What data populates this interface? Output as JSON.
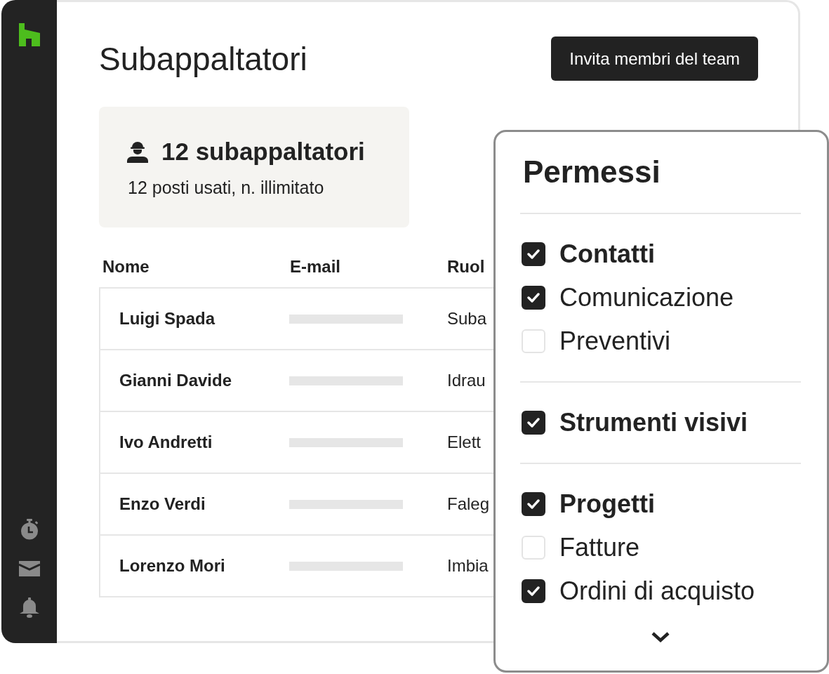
{
  "page": {
    "title": "Subappaltatori",
    "invite_button": "Invita membri del team"
  },
  "summary_card": {
    "count": "12 subappaltatori",
    "detail": "12 posti usati, n. illimitato"
  },
  "table": {
    "columns": [
      "Nome",
      "E-mail",
      "Ruol"
    ],
    "rows": [
      {
        "name": "Luigi Spada",
        "role": "Suba"
      },
      {
        "name": "Gianni Davide",
        "role": "Idrau"
      },
      {
        "name": "Ivo Andretti",
        "role": "Elett"
      },
      {
        "name": "Enzo Verdi",
        "role": "Faleg"
      },
      {
        "name": "Lorenzo Mori",
        "role": "Imbia"
      }
    ]
  },
  "permissions": {
    "title": "Permessi",
    "groups": [
      {
        "label": "Contatti",
        "checked": true,
        "children": [
          {
            "label": "Comunicazione",
            "checked": true
          },
          {
            "label": "Preventivi",
            "checked": false
          }
        ]
      },
      {
        "label": "Strumenti visivi",
        "checked": true
      },
      {
        "label": "Progetti",
        "checked": true,
        "children": [
          {
            "label": "Fatture",
            "checked": false
          },
          {
            "label": "Ordini di acquisto",
            "checked": true
          }
        ]
      }
    ]
  }
}
